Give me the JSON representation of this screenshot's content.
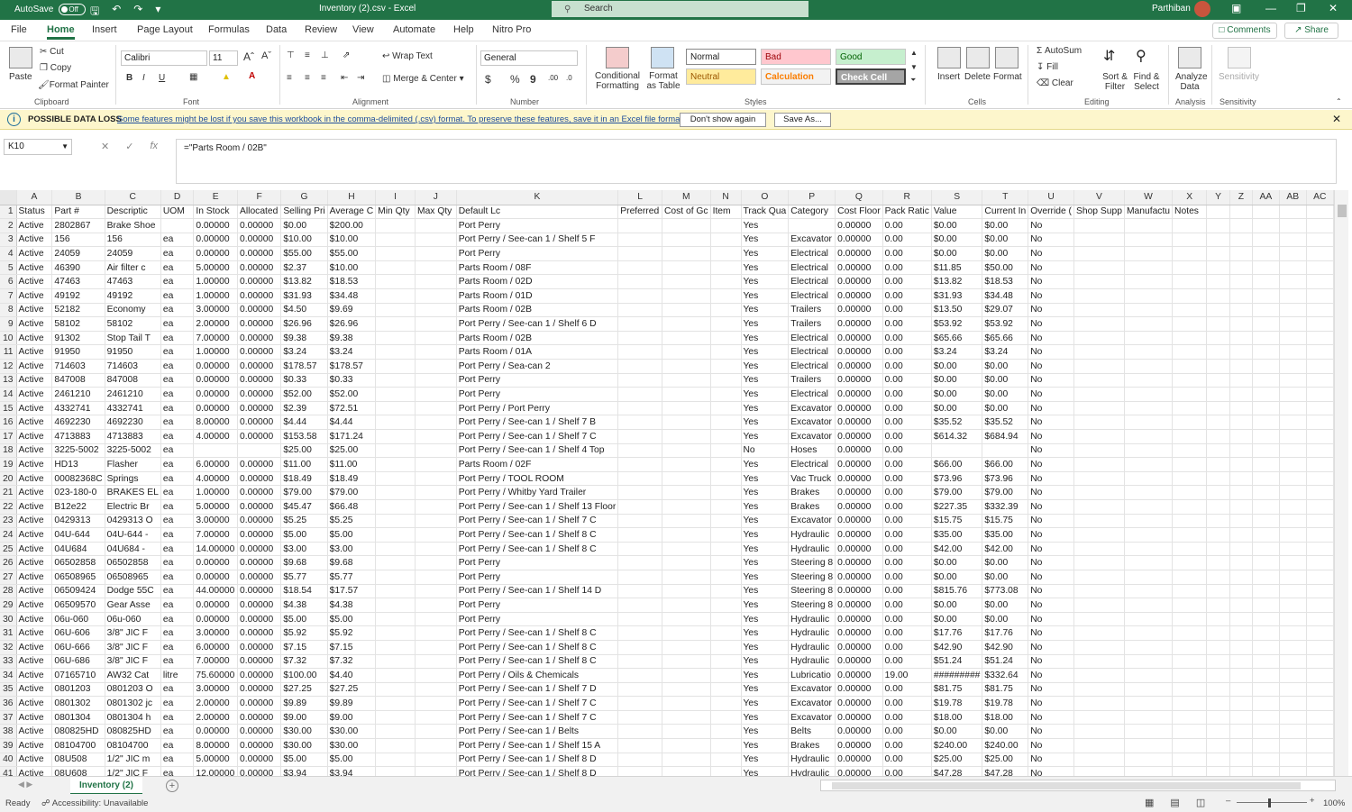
{
  "titlebar": {
    "autosave": "AutoSave",
    "toggle": "Off",
    "doc_title": "Inventory (2).csv  -  Excel",
    "search_placeholder": "Search",
    "user": "Parthiban"
  },
  "menu": {
    "tabs": [
      "File",
      "Home",
      "Insert",
      "Page Layout",
      "Formulas",
      "Data",
      "Review",
      "View",
      "Automate",
      "Help",
      "Nitro Pro"
    ],
    "comments": "Comments",
    "share": "Share"
  },
  "ribbon": {
    "clipboard": {
      "paste": "Paste",
      "cut": "Cut",
      "copy": "Copy",
      "format_painter": "Format Painter",
      "label": "Clipboard"
    },
    "font": {
      "name": "Calibri",
      "size": "11",
      "label": "Font"
    },
    "alignment": {
      "wrap": "Wrap Text",
      "merge": "Merge & Center",
      "label": "Alignment"
    },
    "number": {
      "format": "General",
      "label": "Number"
    },
    "styles": {
      "conditional": "Conditional Formatting",
      "format_table": "Format as Table",
      "normal": "Normal",
      "bad": "Bad",
      "good": "Good",
      "neutral": "Neutral",
      "calculation": "Calculation",
      "check_cell": "Check Cell",
      "label": "Styles"
    },
    "cells": {
      "insert": "Insert",
      "delete": "Delete",
      "format": "Format",
      "label": "Cells"
    },
    "editing": {
      "autosum": "AutoSum",
      "fill": "Fill",
      "clear": "Clear",
      "sort": "Sort & Filter",
      "find": "Find & Select",
      "label": "Editing"
    },
    "analysis": {
      "analyze": "Analyze Data",
      "label": "Analysis"
    },
    "sensitivity": {
      "btn": "Sensitivity",
      "label": "Sensitivity"
    }
  },
  "infobar": {
    "title": "POSSIBLE DATA LOSS",
    "message": "Some features might be lost if you save this workbook in the comma-delimited (.csv) format. To preserve these features, save it in an Excel file format.",
    "dont_show": "Don't show again",
    "save_as": "Save As..."
  },
  "formula_bar": {
    "cell": "K10",
    "formula": "=\"Parts Room / 02B\""
  },
  "sheet": {
    "columns": [
      "A",
      "B",
      "C",
      "D",
      "E",
      "F",
      "G",
      "H",
      "I",
      "J",
      "K",
      "L",
      "M",
      "N",
      "O",
      "P",
      "Q",
      "R",
      "S",
      "T",
      "U",
      "V",
      "W",
      "X",
      "Y",
      "Z",
      "AA",
      "AB",
      "AC"
    ],
    "rows": [
      [
        "Status",
        "Part #",
        "Descriptic",
        "UOM",
        "In Stock",
        "Allocated",
        "Selling Pri",
        "Average C",
        "Min Qty",
        "Max Qty",
        "Default Lc",
        "Preferred",
        "Cost of Gc",
        "Item",
        "Track Qua",
        "Category",
        "Cost Floor",
        "Pack Ratic",
        "Value",
        "Current In",
        "Override (",
        "Shop Supp",
        "Manufactu",
        "Notes"
      ],
      [
        "Active",
        "2802867",
        "Brake Shoe",
        "",
        "0.00000",
        "0.00000",
        "$0.00",
        "$200.00",
        "",
        "",
        "Port Perry",
        "",
        "",
        "",
        "Yes",
        "",
        "0.00000",
        "0.00",
        "$0.00",
        "$0.00",
        "No"
      ],
      [
        "Active",
        "156",
        "156",
        "ea",
        "0.00000",
        "0.00000",
        "$10.00",
        "$10.00",
        "",
        "",
        "Port Perry / See-can 1 / Shelf 5 F",
        "",
        "",
        "",
        "Yes",
        "Excavator",
        "0.00000",
        "0.00",
        "$0.00",
        "$0.00",
        "No"
      ],
      [
        "Active",
        "24059",
        "24059",
        "ea",
        "0.00000",
        "0.00000",
        "$55.00",
        "$55.00",
        "",
        "",
        "Port Perry",
        "",
        "",
        "",
        "Yes",
        "Electrical",
        "0.00000",
        "0.00",
        "$0.00",
        "$0.00",
        "No"
      ],
      [
        "Active",
        "46390",
        "Air filter c",
        "ea",
        "5.00000",
        "0.00000",
        "$2.37",
        "$10.00",
        "",
        "",
        "Parts Room / 08F",
        "",
        "",
        "",
        "Yes",
        "Electrical",
        "0.00000",
        "0.00",
        "$11.85",
        "$50.00",
        "No"
      ],
      [
        "Active",
        "47463",
        "47463",
        "ea",
        "1.00000",
        "0.00000",
        "$13.82",
        "$18.53",
        "",
        "",
        "Parts Room / 02D",
        "",
        "",
        "",
        "Yes",
        "Electrical",
        "0.00000",
        "0.00",
        "$13.82",
        "$18.53",
        "No"
      ],
      [
        "Active",
        "49192",
        "49192",
        "ea",
        "1.00000",
        "0.00000",
        "$31.93",
        "$34.48",
        "",
        "",
        "Parts Room / 01D",
        "",
        "",
        "",
        "Yes",
        "Electrical",
        "0.00000",
        "0.00",
        "$31.93",
        "$34.48",
        "No"
      ],
      [
        "Active",
        "52182",
        "Economy",
        "ea",
        "3.00000",
        "0.00000",
        "$4.50",
        "$9.69",
        "",
        "",
        "Parts Room / 02B",
        "",
        "",
        "",
        "Yes",
        "Trailers",
        "0.00000",
        "0.00",
        "$13.50",
        "$29.07",
        "No"
      ],
      [
        "Active",
        "58102",
        "58102",
        "ea",
        "2.00000",
        "0.00000",
        "$26.96",
        "$26.96",
        "",
        "",
        "Port Perry / See-can 1 / Shelf 6 D",
        "",
        "",
        "",
        "Yes",
        "Trailers",
        "0.00000",
        "0.00",
        "$53.92",
        "$53.92",
        "No"
      ],
      [
        "Active",
        "91302",
        "Stop Tail T",
        "ea",
        "7.00000",
        "0.00000",
        "$9.38",
        "$9.38",
        "",
        "",
        "Parts Room / 02B",
        "",
        "",
        "",
        "Yes",
        "Electrical",
        "0.00000",
        "0.00",
        "$65.66",
        "$65.66",
        "No"
      ],
      [
        "Active",
        "91950",
        "91950",
        "ea",
        "1.00000",
        "0.00000",
        "$3.24",
        "$3.24",
        "",
        "",
        "Parts Room / 01A",
        "",
        "",
        "",
        "Yes",
        "Electrical",
        "0.00000",
        "0.00",
        "$3.24",
        "$3.24",
        "No"
      ],
      [
        "Active",
        "714603",
        "714603",
        "ea",
        "0.00000",
        "0.00000",
        "$178.57",
        "$178.57",
        "",
        "",
        "Port Perry / Sea-can 2",
        "",
        "",
        "",
        "Yes",
        "Electrical",
        "0.00000",
        "0.00",
        "$0.00",
        "$0.00",
        "No"
      ],
      [
        "Active",
        "847008",
        "847008",
        "ea",
        "0.00000",
        "0.00000",
        "$0.33",
        "$0.33",
        "",
        "",
        "Port Perry",
        "",
        "",
        "",
        "Yes",
        "Trailers",
        "0.00000",
        "0.00",
        "$0.00",
        "$0.00",
        "No"
      ],
      [
        "Active",
        "2461210",
        "2461210",
        "ea",
        "0.00000",
        "0.00000",
        "$52.00",
        "$52.00",
        "",
        "",
        "Port Perry",
        "",
        "",
        "",
        "Yes",
        "Electrical",
        "0.00000",
        "0.00",
        "$0.00",
        "$0.00",
        "No"
      ],
      [
        "Active",
        "4332741",
        "4332741",
        "ea",
        "0.00000",
        "0.00000",
        "$2.39",
        "$72.51",
        "",
        "",
        "Port Perry / Port Perry",
        "",
        "",
        "",
        "Yes",
        "Excavator",
        "0.00000",
        "0.00",
        "$0.00",
        "$0.00",
        "No"
      ],
      [
        "Active",
        "4692230",
        "4692230",
        "ea",
        "8.00000",
        "0.00000",
        "$4.44",
        "$4.44",
        "",
        "",
        "Port Perry / See-can 1 / Shelf 7 B",
        "",
        "",
        "",
        "Yes",
        "Excavator",
        "0.00000",
        "0.00",
        "$35.52",
        "$35.52",
        "No"
      ],
      [
        "Active",
        "4713883",
        "4713883",
        "ea",
        "4.00000",
        "0.00000",
        "$153.58",
        "$171.24",
        "",
        "",
        "Port Perry / See-can 1 / Shelf 7 C",
        "",
        "",
        "",
        "Yes",
        "Excavator",
        "0.00000",
        "0.00",
        "$614.32",
        "$684.94",
        "No"
      ],
      [
        "Active",
        "3225-5002",
        "3225-5002",
        "ea",
        "",
        "",
        "$25.00",
        "$25.00",
        "",
        "",
        "Port Perry / See-can 1 / Shelf 4 Top",
        "",
        "",
        "",
        "No",
        "Hoses",
        "0.00000",
        "0.00",
        "",
        "",
        "No"
      ],
      [
        "Active",
        "HD13",
        "Flasher",
        "ea",
        "6.00000",
        "0.00000",
        "$11.00",
        "$11.00",
        "",
        "",
        "Parts Room / 02F",
        "",
        "",
        "",
        "Yes",
        "Electrical",
        "0.00000",
        "0.00",
        "$66.00",
        "$66.00",
        "No"
      ],
      [
        "Active",
        "00082368C",
        "Springs",
        "ea",
        "4.00000",
        "0.00000",
        "$18.49",
        "$18.49",
        "",
        "",
        "Port Perry / TOOL ROOM",
        "",
        "",
        "",
        "Yes",
        "Vac Truck",
        "0.00000",
        "0.00",
        "$73.96",
        "$73.96",
        "No"
      ],
      [
        "Active",
        "023-180-0",
        "BRAKES EL",
        "ea",
        "1.00000",
        "0.00000",
        "$79.00",
        "$79.00",
        "",
        "",
        "Port Perry / Whitby Yard Trailer",
        "",
        "",
        "",
        "Yes",
        "Brakes",
        "0.00000",
        "0.00",
        "$79.00",
        "$79.00",
        "No"
      ],
      [
        "Active",
        "B12e22",
        "Electric Br",
        "ea",
        "5.00000",
        "0.00000",
        "$45.47",
        "$66.48",
        "",
        "",
        "Port Perry / See-can 1 / Shelf 13 Floor",
        "",
        "",
        "",
        "Yes",
        "Brakes",
        "0.00000",
        "0.00",
        "$227.35",
        "$332.39",
        "No"
      ],
      [
        "Active",
        "0429313",
        "0429313 O",
        "ea",
        "3.00000",
        "0.00000",
        "$5.25",
        "$5.25",
        "",
        "",
        "Port Perry / See-can 1 / Shelf 7 C",
        "",
        "",
        "",
        "Yes",
        "Excavator",
        "0.00000",
        "0.00",
        "$15.75",
        "$15.75",
        "No"
      ],
      [
        "Active",
        "04U-644",
        "04U-644 -",
        "ea",
        "7.00000",
        "0.00000",
        "$5.00",
        "$5.00",
        "",
        "",
        "Port Perry / See-can 1 / Shelf 8 C",
        "",
        "",
        "",
        "Yes",
        "Hydraulic",
        "0.00000",
        "0.00",
        "$35.00",
        "$35.00",
        "No"
      ],
      [
        "Active",
        "04U684",
        "04U684 -",
        "ea",
        "14.00000",
        "0.00000",
        "$3.00",
        "$3.00",
        "",
        "",
        "Port Perry / See-can 1 / Shelf 8 C",
        "",
        "",
        "",
        "Yes",
        "Hydraulic",
        "0.00000",
        "0.00",
        "$42.00",
        "$42.00",
        "No"
      ],
      [
        "Active",
        "06502858",
        "06502858",
        "ea",
        "0.00000",
        "0.00000",
        "$9.68",
        "$9.68",
        "",
        "",
        "Port Perry",
        "",
        "",
        "",
        "Yes",
        "Steering 8",
        "0.00000",
        "0.00",
        "$0.00",
        "$0.00",
        "No"
      ],
      [
        "Active",
        "06508965",
        "06508965",
        "ea",
        "0.00000",
        "0.00000",
        "$5.77",
        "$5.77",
        "",
        "",
        "Port Perry",
        "",
        "",
        "",
        "Yes",
        "Steering 8",
        "0.00000",
        "0.00",
        "$0.00",
        "$0.00",
        "No"
      ],
      [
        "Active",
        "06509424",
        "Dodge 55C",
        "ea",
        "44.00000",
        "0.00000",
        "$18.54",
        "$17.57",
        "",
        "",
        "Port Perry / See-can 1 / Shelf 14 D",
        "",
        "",
        "",
        "Yes",
        "Steering 8",
        "0.00000",
        "0.00",
        "$815.76",
        "$773.08",
        "No"
      ],
      [
        "Active",
        "06509570",
        "Gear Asse",
        "ea",
        "0.00000",
        "0.00000",
        "$4.38",
        "$4.38",
        "",
        "",
        "Port Perry",
        "",
        "",
        "",
        "Yes",
        "Steering 8",
        "0.00000",
        "0.00",
        "$0.00",
        "$0.00",
        "No"
      ],
      [
        "Active",
        "06u-060",
        "06u-060",
        "ea",
        "0.00000",
        "0.00000",
        "$5.00",
        "$5.00",
        "",
        "",
        "Port Perry",
        "",
        "",
        "",
        "Yes",
        "Hydraulic",
        "0.00000",
        "0.00",
        "$0.00",
        "$0.00",
        "No"
      ],
      [
        "Active",
        "06U-606",
        "3/8\" JIC F",
        "ea",
        "3.00000",
        "0.00000",
        "$5.92",
        "$5.92",
        "",
        "",
        "Port Perry / See-can 1 / Shelf 8 C",
        "",
        "",
        "",
        "Yes",
        "Hydraulic",
        "0.00000",
        "0.00",
        "$17.76",
        "$17.76",
        "No"
      ],
      [
        "Active",
        "06U-666",
        "3/8\" JIC F",
        "ea",
        "6.00000",
        "0.00000",
        "$7.15",
        "$7.15",
        "",
        "",
        "Port Perry / See-can 1 / Shelf 8 C",
        "",
        "",
        "",
        "Yes",
        "Hydraulic",
        "0.00000",
        "0.00",
        "$42.90",
        "$42.90",
        "No"
      ],
      [
        "Active",
        "06U-686",
        "3/8\" JIC F",
        "ea",
        "7.00000",
        "0.00000",
        "$7.32",
        "$7.32",
        "",
        "",
        "Port Perry / See-can 1 / Shelf 8 C",
        "",
        "",
        "",
        "Yes",
        "Hydraulic",
        "0.00000",
        "0.00",
        "$51.24",
        "$51.24",
        "No"
      ],
      [
        "Active",
        "07165710",
        "AW32 Cat",
        "litre",
        "75.60000",
        "0.00000",
        "$100.00",
        "$4.40",
        "",
        "",
        "Port Perry / Oils & Chemicals",
        "",
        "",
        "",
        "Yes",
        "Lubricatio",
        "0.00000",
        "19.00",
        "#########",
        "$332.64",
        "No"
      ],
      [
        "Active",
        "0801203",
        "0801203 O",
        "ea",
        "3.00000",
        "0.00000",
        "$27.25",
        "$27.25",
        "",
        "",
        "Port Perry / See-can 1 / Shelf 7 D",
        "",
        "",
        "",
        "Yes",
        "Excavator",
        "0.00000",
        "0.00",
        "$81.75",
        "$81.75",
        "No"
      ],
      [
        "Active",
        "0801302",
        "0801302 jc",
        "ea",
        "2.00000",
        "0.00000",
        "$9.89",
        "$9.89",
        "",
        "",
        "Port Perry / See-can 1 / Shelf 7 C",
        "",
        "",
        "",
        "Yes",
        "Excavator",
        "0.00000",
        "0.00",
        "$19.78",
        "$19.78",
        "No"
      ],
      [
        "Active",
        "0801304",
        "0801304 h",
        "ea",
        "2.00000",
        "0.00000",
        "$9.00",
        "$9.00",
        "",
        "",
        "Port Perry / See-can 1 / Shelf 7 C",
        "",
        "",
        "",
        "Yes",
        "Excavator",
        "0.00000",
        "0.00",
        "$18.00",
        "$18.00",
        "No"
      ],
      [
        "Active",
        "080825HD",
        "080825HD",
        "ea",
        "0.00000",
        "0.00000",
        "$30.00",
        "$30.00",
        "",
        "",
        "Port Perry / See-can 1 / Belts",
        "",
        "",
        "",
        "Yes",
        "Belts",
        "0.00000",
        "0.00",
        "$0.00",
        "$0.00",
        "No"
      ],
      [
        "Active",
        "08104700",
        "08104700",
        "ea",
        "8.00000",
        "0.00000",
        "$30.00",
        "$30.00",
        "",
        "",
        "Port Perry / See-can 1 / Shelf 15 A",
        "",
        "",
        "",
        "Yes",
        "Brakes",
        "0.00000",
        "0.00",
        "$240.00",
        "$240.00",
        "No"
      ],
      [
        "Active",
        "08U508",
        "1/2\" JIC m",
        "ea",
        "5.00000",
        "0.00000",
        "$5.00",
        "$5.00",
        "",
        "",
        "Port Perry / See-can 1 / Shelf 8 D",
        "",
        "",
        "",
        "Yes",
        "Hydraulic",
        "0.00000",
        "0.00",
        "$25.00",
        "$25.00",
        "No"
      ],
      [
        "Active",
        "08U608",
        "1/2\" JIC F",
        "ea",
        "12.00000",
        "0.00000",
        "$3.94",
        "$3.94",
        "",
        "",
        "Port Perry / See-can 1 / Shelf 8 D",
        "",
        "",
        "",
        "Yes",
        "Hydraulic",
        "0.00000",
        "0.00",
        "$47.28",
        "$47.28",
        "No"
      ]
    ]
  },
  "sheet_tab": "Inventory (2)",
  "status": {
    "ready": "Ready",
    "accessibility": "Accessibility: Unavailable",
    "zoom": "100%"
  },
  "colors": {
    "accent": "#217346",
    "infobar": "#fdf6cc",
    "bad_bg": "#ffc7ce",
    "good_bg": "#c6efce",
    "neutral_bg": "#ffeb9c",
    "check_bg": "#a5a5a5"
  }
}
